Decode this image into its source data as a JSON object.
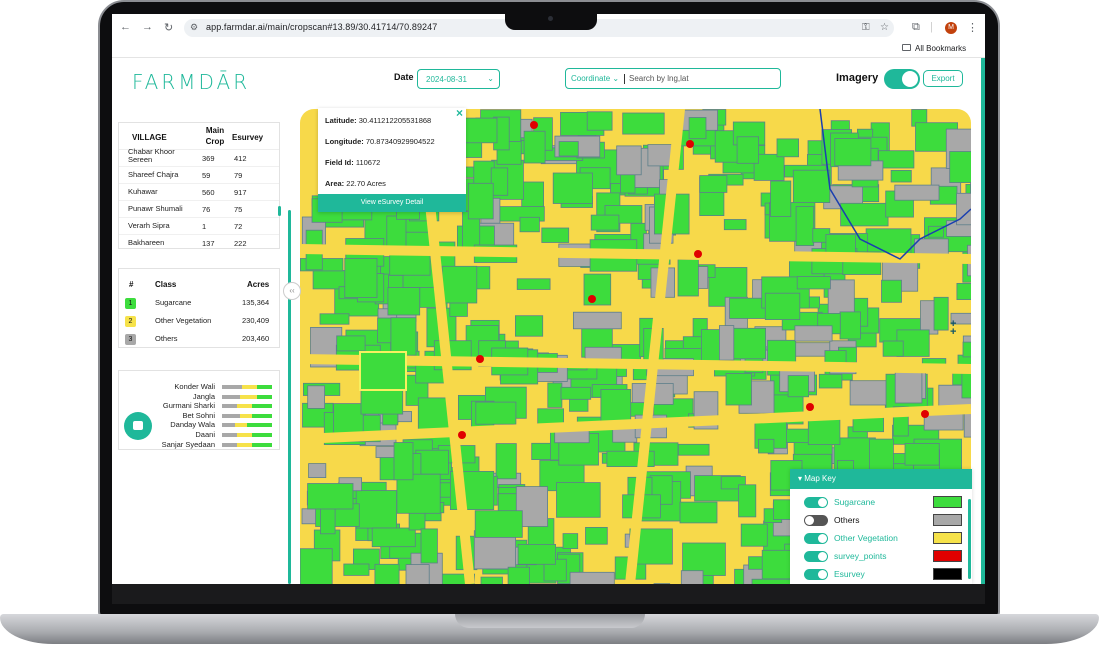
{
  "browser": {
    "url": "app.farmdar.ai/main/cropscan#13.89/30.41714/70.89247",
    "bookmarks_label": "All Bookmarks",
    "avatar_letter": "M"
  },
  "header": {
    "logo": "FARMDĀR",
    "date_label": "Date",
    "date_value": "2024-08-31",
    "coord_select": "Coordinate",
    "search_placeholder": "Search by lng,lat",
    "imagery_label": "Imagery",
    "export_label": "Export"
  },
  "village_table": {
    "headers": [
      "VILLAGE",
      "Main Crop",
      "Esurvey"
    ],
    "rows": [
      {
        "village": "Chabar Khoor Sereen",
        "main_crop": "369",
        "esurvey": "412"
      },
      {
        "village": "Shareef Chajra",
        "main_crop": "59",
        "esurvey": "79"
      },
      {
        "village": "Kuhawar",
        "main_crop": "560",
        "esurvey": "917"
      },
      {
        "village": "Punawr Shumali",
        "main_crop": "76",
        "esurvey": "75"
      },
      {
        "village": "Verarh Sipra",
        "main_crop": "1",
        "esurvey": "72"
      },
      {
        "village": "Bakhareen",
        "main_crop": "137",
        "esurvey": "222"
      }
    ]
  },
  "class_table": {
    "headers": [
      "#",
      "Class",
      "Acres"
    ],
    "rows": [
      {
        "num": "1",
        "class": "Sugarcane",
        "acres": "135,364",
        "color": "#3ddc3d"
      },
      {
        "num": "2",
        "class": "Other Vegetation",
        "acres": "230,409",
        "color": "#f6e24a"
      },
      {
        "num": "3",
        "class": "Others",
        "acres": "203,460",
        "color": "#a8a8a8"
      }
    ]
  },
  "village_bars": [
    {
      "name": "Konder Wali",
      "gray": 0.4,
      "yellow": 0.3,
      "green": 0.3
    },
    {
      "name": "Jangla",
      "gray": 0.35,
      "yellow": 0.35,
      "green": 0.3
    },
    {
      "name": "Gurmani Sharki",
      "gray": 0.3,
      "yellow": 0.3,
      "green": 0.4
    },
    {
      "name": "Bet Sohni",
      "gray": 0.35,
      "yellow": 0.25,
      "green": 0.4
    },
    {
      "name": "Danday Wala",
      "gray": 0.25,
      "yellow": 0.25,
      "green": 0.5
    },
    {
      "name": "Daani",
      "gray": 0.3,
      "yellow": 0.3,
      "green": 0.4
    },
    {
      "name": "Sanjar Syedaan",
      "gray": 0.3,
      "yellow": 0.3,
      "green": 0.4
    }
  ],
  "popup": {
    "latitude_label": "Latitude:",
    "latitude": "30.411212205531868",
    "longitude_label": "Longitude:",
    "longitude": "70.87340929904522",
    "field_id_label": "Field Id:",
    "field_id": "110672",
    "area_label": "Area:",
    "area": "22.70 Acres",
    "button": "View eSurvey Detail"
  },
  "map_key": {
    "title": "Map Key",
    "items": [
      {
        "label": "Sugarcane",
        "on": true,
        "color": "#3ddc3d",
        "label_color": "#1fb89a"
      },
      {
        "label": "Others",
        "on": false,
        "color": "#a8a8a8",
        "label_color": "#111111"
      },
      {
        "label": "Other Vegetation",
        "on": true,
        "color": "#f6e24a",
        "label_color": "#1fb89a"
      },
      {
        "label": "survey_points",
        "on": true,
        "color": "#e00000",
        "label_color": "#1fb89a"
      },
      {
        "label": "Esurvey",
        "on": true,
        "color": "#000000",
        "label_color": "#1fb89a"
      }
    ]
  },
  "colors": {
    "accent": "#1fb89a",
    "sugarcane": "#3ddc3d",
    "other_vegetation": "#f6e24a",
    "others": "#a8a8a8"
  }
}
